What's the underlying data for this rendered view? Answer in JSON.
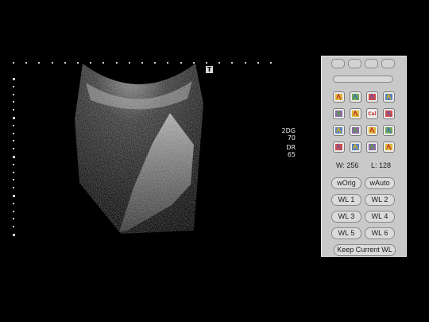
{
  "viewer": {
    "marker": "T",
    "info_top": [
      "2DG",
      "70"
    ],
    "info_bottom": [
      "DR",
      "65"
    ]
  },
  "panel": {
    "tools": [
      {
        "name": "hand-tool-icon"
      },
      {
        "name": "zoom-tool-icon"
      },
      {
        "name": "pan-tool-icon"
      },
      {
        "name": "flag-tool-icon"
      },
      {
        "name": "measure-tool-icon"
      },
      {
        "name": "copy-tool-icon"
      },
      {
        "name": "calibrate-tool-icon",
        "label": "Cal"
      },
      {
        "name": "magnify-tool-icon"
      },
      {
        "name": "book-tool-icon"
      },
      {
        "name": "bookmark-tool-icon"
      },
      {
        "name": "save-tool-icon"
      },
      {
        "name": "layers-tool-icon"
      },
      {
        "name": "settings-tool-icon"
      },
      {
        "name": "reset-tool-icon"
      },
      {
        "name": "disk-tool-icon"
      },
      {
        "name": "print-tool-icon"
      }
    ],
    "window_label": "W: 256",
    "level_label": "L: 128",
    "buttons": {
      "worig": "wOrig",
      "wauto": "wAuto",
      "wl1": "WL 1",
      "wl2": "WL 2",
      "wl3": "WL 3",
      "wl4": "WL 4",
      "wl5": "WL 5",
      "wl6": "WL 6",
      "keep": "Keep Current WL"
    }
  }
}
